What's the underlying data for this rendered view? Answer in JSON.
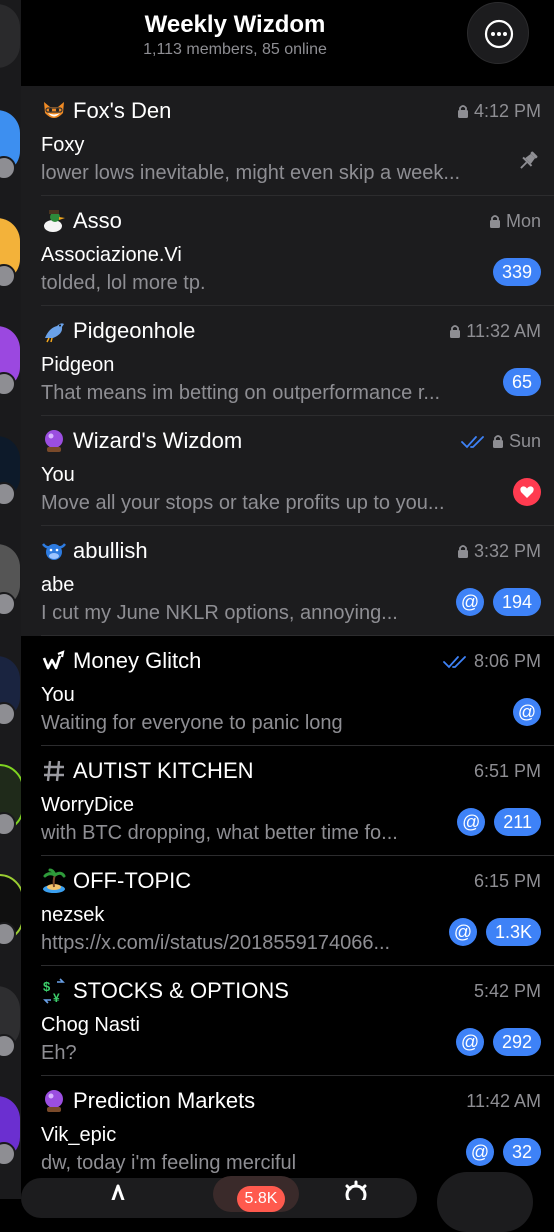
{
  "header": {
    "title": "Weekly Wizdom",
    "subtitle": "1,113 members, 85 online"
  },
  "colors": {
    "background": "#000000",
    "highlight_row": "#1c1c1e",
    "accent": "#3e82f7",
    "muted": "#8e8e93",
    "reaction": "#ff3b50"
  },
  "chats": [
    {
      "icon": "fox-emoji-icon",
      "name": "Fox's Den",
      "time": "4:12 PM",
      "locked": true,
      "read": false,
      "sender": "Foxy",
      "preview": "lower lows inevitable, might even skip a week...",
      "pinned": true,
      "mention": false,
      "count": ""
    },
    {
      "icon": "duck-emoji-icon",
      "name": "Asso",
      "time": "Mon",
      "locked": true,
      "read": false,
      "sender": "Associazione.Vi",
      "preview": "tolded, lol more tp.",
      "pinned": false,
      "mention": false,
      "count": "339"
    },
    {
      "icon": "pigeon-emoji-icon",
      "name": "Pidgeonhole",
      "time": "11:32 AM",
      "locked": true,
      "read": false,
      "sender": "Pidgeon",
      "preview": "That means im betting on outperformance r...",
      "pinned": false,
      "mention": false,
      "count": "65"
    },
    {
      "icon": "crystal-ball-emoji-icon",
      "name": "Wizard's Wizdom",
      "time": "Sun",
      "locked": true,
      "read": true,
      "sender": "You",
      "preview": "Move all your stops or take profits up to you...",
      "pinned": false,
      "mention": false,
      "count": "",
      "heart": true
    },
    {
      "icon": "ox-emoji-icon",
      "name": "abullish",
      "time": "3:32 PM",
      "locked": true,
      "read": false,
      "sender": "abe",
      "preview": "I cut my June NKLR options, annoying...",
      "pinned": false,
      "mention": true,
      "count": "194"
    },
    {
      "icon": "chart-logo-icon",
      "name": "Money Glitch",
      "time": "8:06 PM",
      "locked": false,
      "read": true,
      "sender": "You",
      "preview": "Waiting for everyone to panic long",
      "pinned": false,
      "mention": true,
      "count": ""
    },
    {
      "icon": "hashtag-icon",
      "name": "AUTIST KITCHEN",
      "time": "6:51 PM",
      "locked": false,
      "read": false,
      "sender": "WorryDice",
      "preview": "with BTC dropping, what better time fo...",
      "pinned": false,
      "mention": true,
      "count": "211"
    },
    {
      "icon": "island-emoji-icon",
      "name": "OFF-TOPIC",
      "time": "6:15 PM",
      "locked": false,
      "read": false,
      "sender": "nezsek",
      "preview": "https://x.com/i/status/2018559174066...",
      "pinned": false,
      "mention": true,
      "count": "1.3K"
    },
    {
      "icon": "currency-exchange-emoji-icon",
      "name": "STOCKS & OPTIONS",
      "time": "5:42 PM",
      "locked": false,
      "read": false,
      "sender": "Chog Nasti",
      "preview": "Eh?",
      "pinned": false,
      "mention": true,
      "count": "292"
    },
    {
      "icon": "crystal-ball-emoji-icon",
      "name": "Prediction Markets",
      "time": "11:42 AM",
      "locked": false,
      "read": false,
      "sender": "Vik_epic",
      "preview": "dw, today i'm feeling merciful",
      "pinned": false,
      "mention": true,
      "count": "32"
    }
  ],
  "tabbar": {
    "badge": "5.8K"
  }
}
